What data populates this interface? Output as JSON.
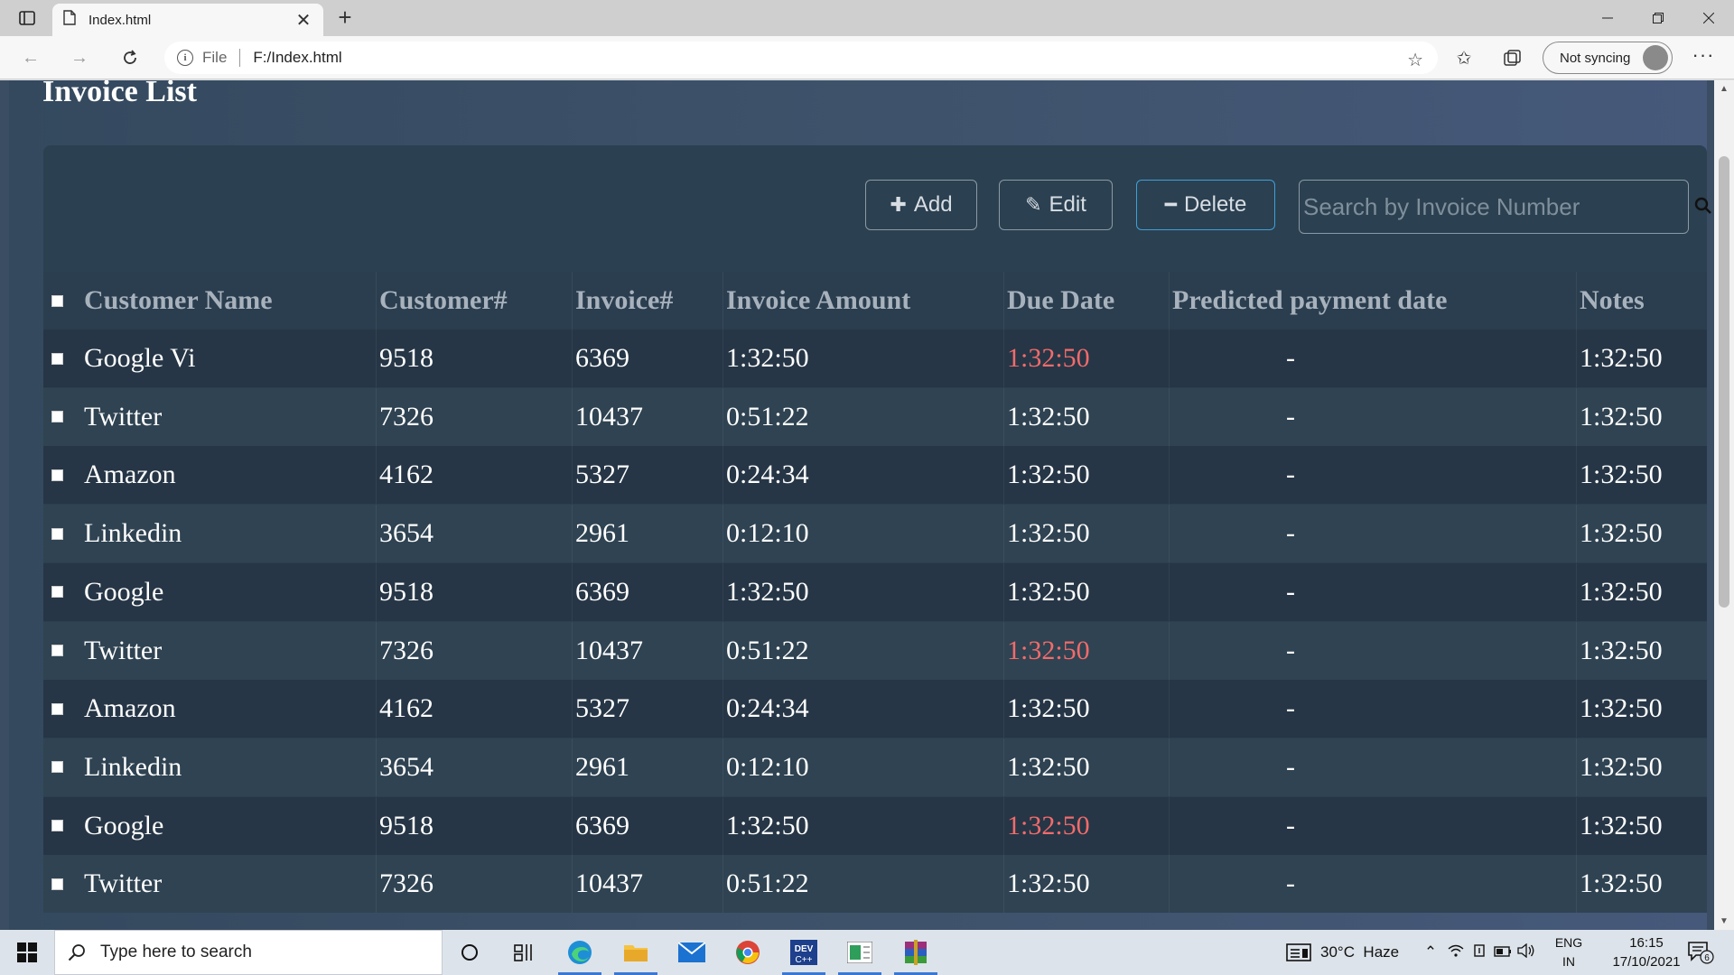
{
  "browser": {
    "tab_title": "Index.html",
    "tab_close": "✕",
    "new_tab": "+",
    "url_scheme": "File",
    "url": "F:/Index.html",
    "profile_label": "Not syncing",
    "more": "···"
  },
  "page": {
    "title": "Invoice List",
    "toolbar": {
      "add_label": "Add",
      "edit_label": "Edit",
      "delete_label": "Delete",
      "search_placeholder": "Search by Invoice Number"
    },
    "table": {
      "columns": [
        "Customer Name",
        "Customer#",
        "Invoice#",
        "Invoice Amount",
        "Due Date",
        "Predicted payment date",
        "Notes"
      ],
      "rows": [
        {
          "name": "Google Vi",
          "customer": "9518",
          "invoice": "6369",
          "amount": "1:32:50",
          "due": "1:32:50",
          "overdue": true,
          "predicted": "-",
          "notes": "1:32:50"
        },
        {
          "name": "Twitter",
          "customer": "7326",
          "invoice": "10437",
          "amount": "0:51:22",
          "due": "1:32:50",
          "overdue": false,
          "predicted": "-",
          "notes": "1:32:50"
        },
        {
          "name": "Amazon",
          "customer": "4162",
          "invoice": "5327",
          "amount": "0:24:34",
          "due": "1:32:50",
          "overdue": false,
          "predicted": "-",
          "notes": "1:32:50"
        },
        {
          "name": "Linkedin",
          "customer": "3654",
          "invoice": "2961",
          "amount": "0:12:10",
          "due": "1:32:50",
          "overdue": false,
          "predicted": "-",
          "notes": "1:32:50"
        },
        {
          "name": "Google",
          "customer": "9518",
          "invoice": "6369",
          "amount": "1:32:50",
          "due": "1:32:50",
          "overdue": false,
          "predicted": "-",
          "notes": "1:32:50"
        },
        {
          "name": "Twitter",
          "customer": "7326",
          "invoice": "10437",
          "amount": "0:51:22",
          "due": "1:32:50",
          "overdue": true,
          "predicted": "-",
          "notes": "1:32:50"
        },
        {
          "name": "Amazon",
          "customer": "4162",
          "invoice": "5327",
          "amount": "0:24:34",
          "due": "1:32:50",
          "overdue": false,
          "predicted": "-",
          "notes": "1:32:50"
        },
        {
          "name": "Linkedin",
          "customer": "3654",
          "invoice": "2961",
          "amount": "0:12:10",
          "due": "1:32:50",
          "overdue": false,
          "predicted": "-",
          "notes": "1:32:50"
        },
        {
          "name": "Google",
          "customer": "9518",
          "invoice": "6369",
          "amount": "1:32:50",
          "due": "1:32:50",
          "overdue": true,
          "predicted": "-",
          "notes": "1:32:50"
        },
        {
          "name": "Twitter",
          "customer": "7326",
          "invoice": "10437",
          "amount": "0:51:22",
          "due": "1:32:50",
          "overdue": false,
          "predicted": "-",
          "notes": "1:32:50"
        }
      ]
    }
  },
  "taskbar": {
    "search_placeholder": "Type here to search",
    "weather": "30°C  Haze",
    "lang_line1": "ENG",
    "lang_line2": "IN",
    "time": "16:15",
    "date": "17/10/2021",
    "notification_count": "6"
  },
  "colors": {
    "overdue": "#f26b6b",
    "delete_border": "#3fa0d9",
    "panel": "#2b4050"
  }
}
